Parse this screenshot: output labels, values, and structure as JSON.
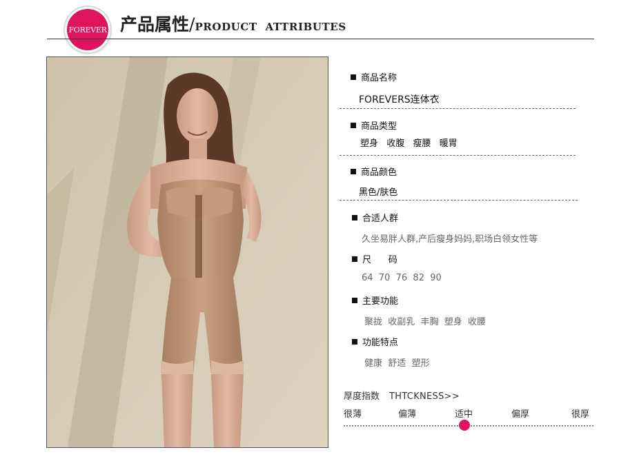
{
  "header": {
    "badge_text": "FOREVER",
    "title_cn": "产品属性",
    "title_sep": "/",
    "title_en": "PRODUCT ATTRIBUTES"
  },
  "colors": {
    "accent": "#e0135f"
  },
  "attributes": [
    {
      "label": "商品名称",
      "value": "FOREVERS连体衣"
    },
    {
      "label": "商品类型",
      "value": "塑身  收腹  瘦腰  暖胃"
    },
    {
      "label": "商品颜色",
      "value": "黑色/肤色"
    },
    {
      "label": "合适人群",
      "value": "久坐易胖人群,产后瘦身妈妈,职场白领女性等"
    },
    {
      "label": "尺      码",
      "value": "64  70  76  82  90"
    },
    {
      "label": "主要功能",
      "value": "聚拢  收副乳  丰胸  塑身  收腰"
    },
    {
      "label": "功能特点",
      "value": "健康  舒适  塑形"
    }
  ],
  "thickness": {
    "label_cn": "厚度指数",
    "label_en": "THTCKNESS>>",
    "scale": [
      "很薄",
      "偏薄",
      "适中",
      "偏厚",
      "很厚"
    ],
    "selected": "适中"
  }
}
